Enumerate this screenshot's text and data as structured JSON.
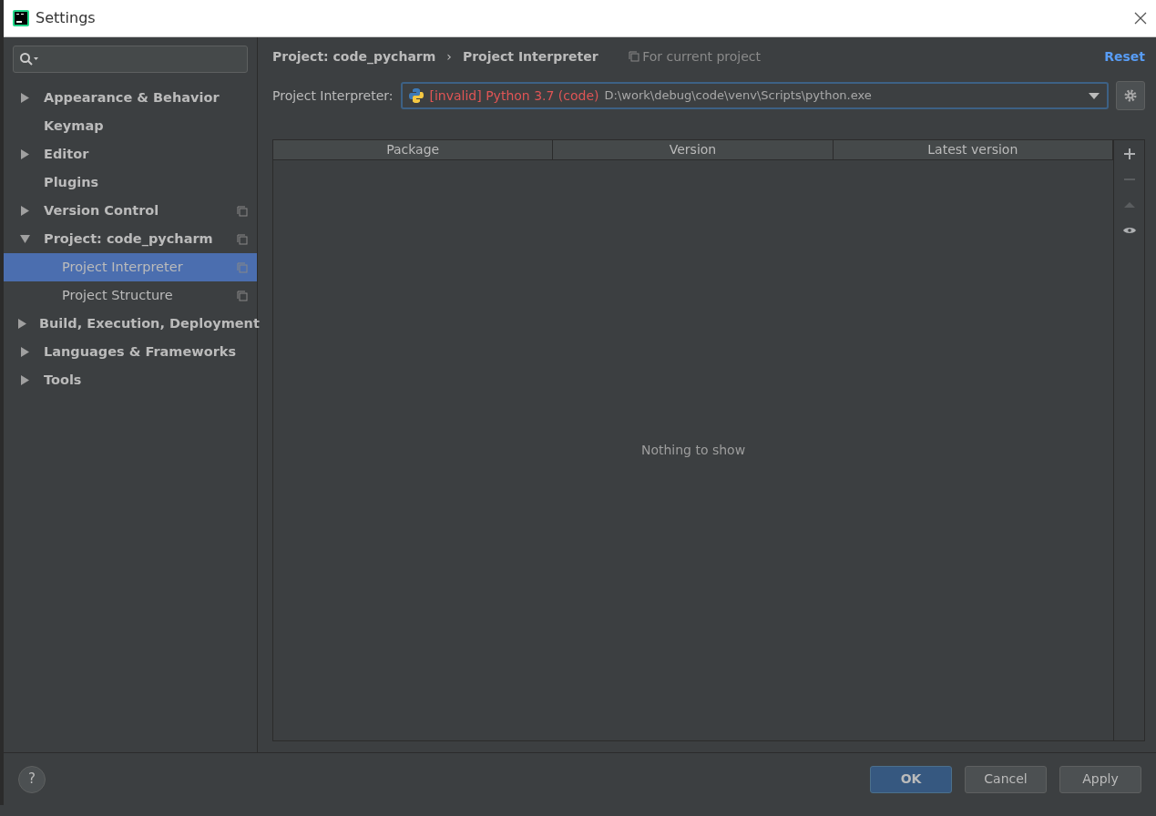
{
  "window": {
    "title": "Settings"
  },
  "sidebar": {
    "items": [
      {
        "label": "Appearance & Behavior",
        "kind": "group",
        "expanded": false,
        "selected": false,
        "project_level": false
      },
      {
        "label": "Keymap",
        "kind": "page",
        "selected": false,
        "project_level": false
      },
      {
        "label": "Editor",
        "kind": "group",
        "expanded": false,
        "selected": false,
        "project_level": false
      },
      {
        "label": "Plugins",
        "kind": "page",
        "selected": false,
        "project_level": false
      },
      {
        "label": "Version Control",
        "kind": "group",
        "expanded": false,
        "selected": false,
        "project_level": true
      },
      {
        "label": "Project: code_pycharm",
        "kind": "group",
        "expanded": true,
        "selected": false,
        "project_level": true,
        "children": [
          {
            "label": "Project Interpreter",
            "kind": "page",
            "selected": true,
            "project_level": true
          },
          {
            "label": "Project Structure",
            "kind": "page",
            "selected": false,
            "project_level": true
          }
        ]
      },
      {
        "label": "Build, Execution, Deployment",
        "kind": "group",
        "expanded": false,
        "selected": false,
        "project_level": false
      },
      {
        "label": "Languages & Frameworks",
        "kind": "group",
        "expanded": false,
        "selected": false,
        "project_level": false
      },
      {
        "label": "Tools",
        "kind": "group",
        "expanded": false,
        "selected": false,
        "project_level": false
      }
    ]
  },
  "breadcrumb": {
    "items": [
      "Project: code_pycharm",
      "Project Interpreter"
    ],
    "separator": "›"
  },
  "scope_note": "For current project",
  "reset": "Reset",
  "interpreter": {
    "label": "Project Interpreter:",
    "name": "[invalid] Python 3.7 (code)",
    "path": "D:\\work\\debug\\code\\venv\\Scripts\\python.exe"
  },
  "table": {
    "columns": [
      "Package",
      "Version",
      "Latest version"
    ],
    "empty_text": "Nothing to show"
  },
  "toolbar": [
    {
      "kind": "add",
      "disabled": false
    },
    {
      "kind": "remove",
      "disabled": true
    },
    {
      "kind": "upgrade",
      "disabled": true
    },
    {
      "kind": "show",
      "disabled": false
    }
  ],
  "help": "?",
  "buttons": [
    {
      "label": "OK",
      "kind": "primary"
    },
    {
      "label": "Cancel",
      "kind": "normal"
    },
    {
      "label": "Apply",
      "kind": "normal"
    }
  ]
}
